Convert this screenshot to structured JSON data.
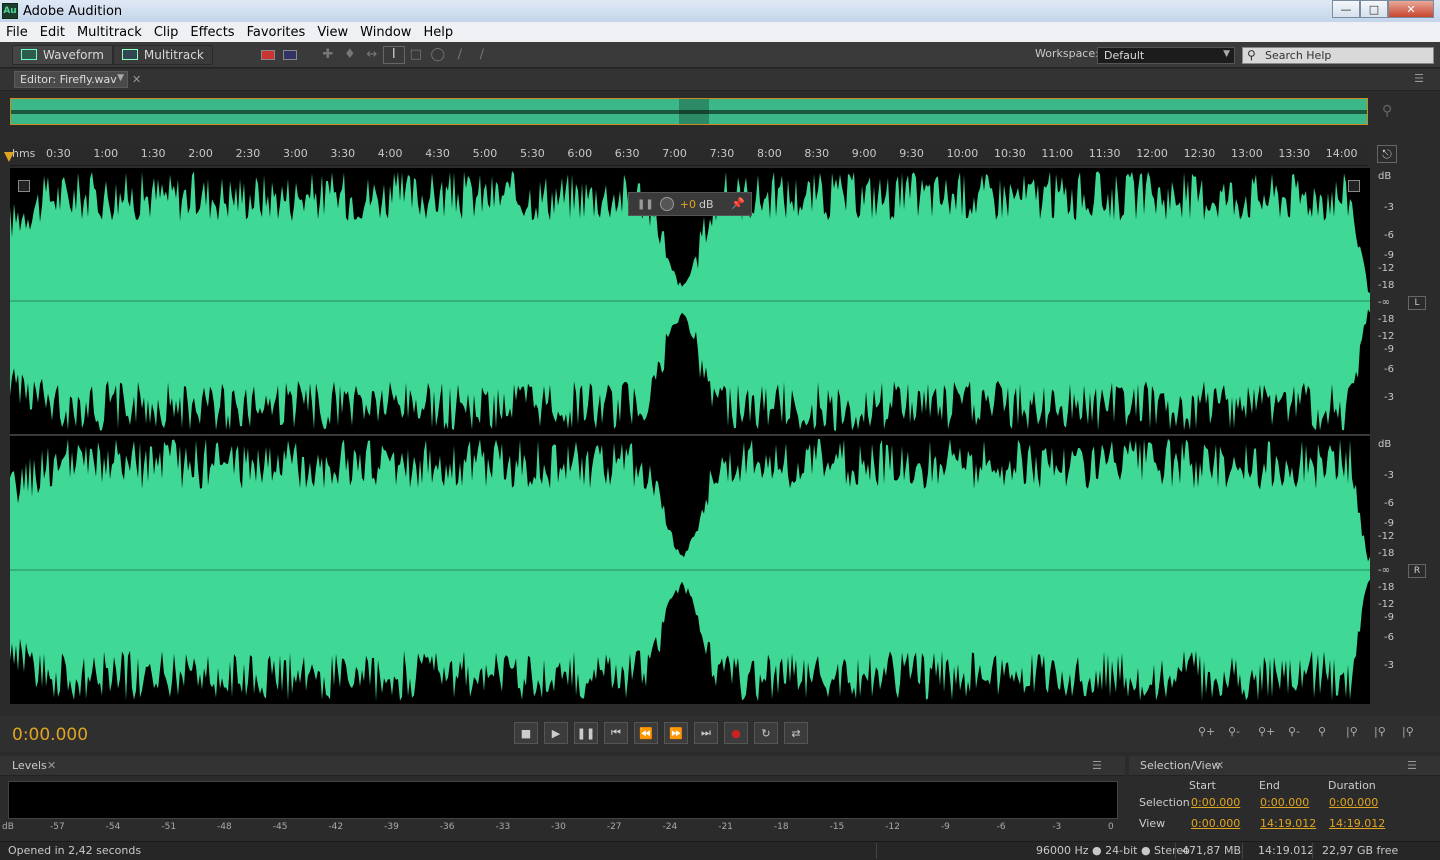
{
  "window": {
    "title": "Adobe Audition",
    "logo": "Au",
    "controls": [
      "minimize",
      "maximize",
      "close"
    ]
  },
  "menu": [
    "File",
    "Edit",
    "Multitrack",
    "Clip",
    "Effects",
    "Favorites",
    "View",
    "Window",
    "Help"
  ],
  "toolbar": {
    "waveform_label": "Waveform",
    "multitrack_label": "Multitrack",
    "workspace_label": "Workspace:",
    "workspace_value": "Default",
    "search_placeholder": "Search Help"
  },
  "editor": {
    "tab_label": "Editor: Firefly.wav"
  },
  "ruler": {
    "unit": "hms",
    "ticks": [
      "0:30",
      "1:00",
      "1:30",
      "2:00",
      "2:30",
      "3:00",
      "3:30",
      "4:00",
      "4:30",
      "5:00",
      "5:30",
      "6:00",
      "6:30",
      "7:00",
      "7:30",
      "8:00",
      "8:30",
      "9:00",
      "9:30",
      "10:00",
      "10:30",
      "11:00",
      "11:30",
      "12:00",
      "12:30",
      "13:00",
      "13:30",
      "14:00"
    ]
  },
  "hud": {
    "value": "+0",
    "unit": "dB"
  },
  "db_scale": {
    "header": "dB",
    "labels": [
      "-3",
      "-6",
      "-9",
      "-12",
      "-18",
      "-∞",
      "-18",
      "-12",
      "-9",
      "-6",
      "-3"
    ],
    "left_channel": "L",
    "right_channel": "R"
  },
  "colors": {
    "waveform": "#3fd894",
    "accent_orange": "#e0a423",
    "background": "#2b2b2b"
  },
  "transport": {
    "timecode": "0:00.000",
    "buttons": [
      "stop-icon",
      "play-icon",
      "pause-icon",
      "go-to-start-icon",
      "rewind-icon",
      "fast-forward-icon",
      "go-to-end-icon",
      "record-icon",
      "loop-icon",
      "skip-selection-icon"
    ]
  },
  "levels": {
    "tab_label": "Levels",
    "scale": [
      "dB",
      "-57",
      "-54",
      "-51",
      "-48",
      "-45",
      "-42",
      "-39",
      "-36",
      "-33",
      "-30",
      "-27",
      "-24",
      "-21",
      "-18",
      "-15",
      "-12",
      "-9",
      "-6",
      "-3",
      "0"
    ]
  },
  "selection_view": {
    "tab_label": "Selection/View",
    "headers": {
      "start": "Start",
      "end": "End",
      "duration": "Duration"
    },
    "selection": {
      "label": "Selection",
      "start": "0:00.000",
      "end": "0:00.000",
      "duration": "0:00.000"
    },
    "view": {
      "label": "View",
      "start": "0:00.000",
      "end": "14:19.012",
      "duration": "14:19.012"
    }
  },
  "status": {
    "message": "Opened in 2,42 seconds",
    "format": "96000 Hz ● 24-bit ● Stereo",
    "size": "471,87 MB",
    "duration": "14:19.012",
    "free": "22,97 GB free"
  }
}
